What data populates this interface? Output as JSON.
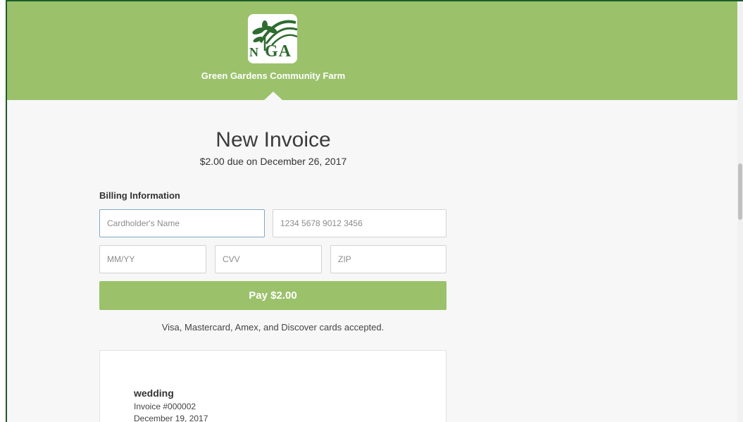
{
  "header": {
    "org_name": "Green Gardens Community Farm",
    "logo_text": "GA",
    "logo_left_letter": "N",
    "brand_color": "#9bc16b"
  },
  "invoice": {
    "title": "New Invoice",
    "due_text": "$2.00 due on December 26, 2017"
  },
  "billing": {
    "section_label": "Billing Information",
    "cardholder_placeholder": "Cardholder's Name",
    "card_number_placeholder": "1234 5678 9012 3456",
    "expiry_placeholder": "MM/YY",
    "cvv_placeholder": "CVV",
    "zip_placeholder": "ZIP",
    "pay_button_label": "Pay $2.00",
    "accepted_cards_text": "Visa, Mastercard, Amex, and Discover cards accepted."
  },
  "invoice_details": {
    "name": "wedding",
    "number": "Invoice #000002",
    "date": "December 19, 2017"
  }
}
